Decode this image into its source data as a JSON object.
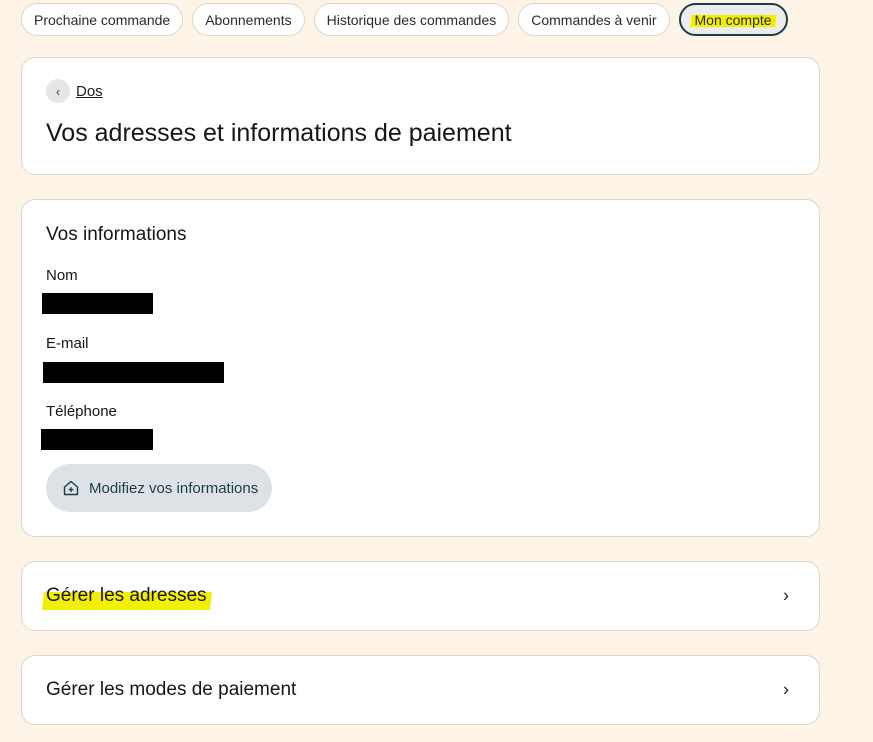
{
  "tabs": [
    {
      "label": "Prochaine commande",
      "active": false
    },
    {
      "label": "Abonnements",
      "active": false
    },
    {
      "label": "Historique des commandes",
      "active": false
    },
    {
      "label": "Commandes à venir",
      "active": false
    },
    {
      "label": "Mon compte",
      "active": true
    }
  ],
  "header": {
    "back_label": "Dos",
    "back_icon": "chevron-left-icon",
    "title": "Vos adresses et informations de paiement"
  },
  "info": {
    "section_title": "Vos informations",
    "fields": [
      {
        "label": "Nom"
      },
      {
        "label": "E-mail"
      },
      {
        "label": "Téléphone"
      }
    ],
    "edit_button": {
      "label": "Modifiez vos informations",
      "icon": "home-icon"
    }
  },
  "rows": [
    {
      "label": "Gérer les adresses",
      "highlighted": true,
      "icon": "chevron-right-icon"
    },
    {
      "label": "Gérer les modes de paiement",
      "highlighted": false,
      "icon": "chevron-right-icon"
    }
  ],
  "colors": {
    "background": "#fdf3e6",
    "highlight": "#f2f000",
    "active_tab_border": "#1e3c46",
    "button_bg": "#dde2e6"
  }
}
